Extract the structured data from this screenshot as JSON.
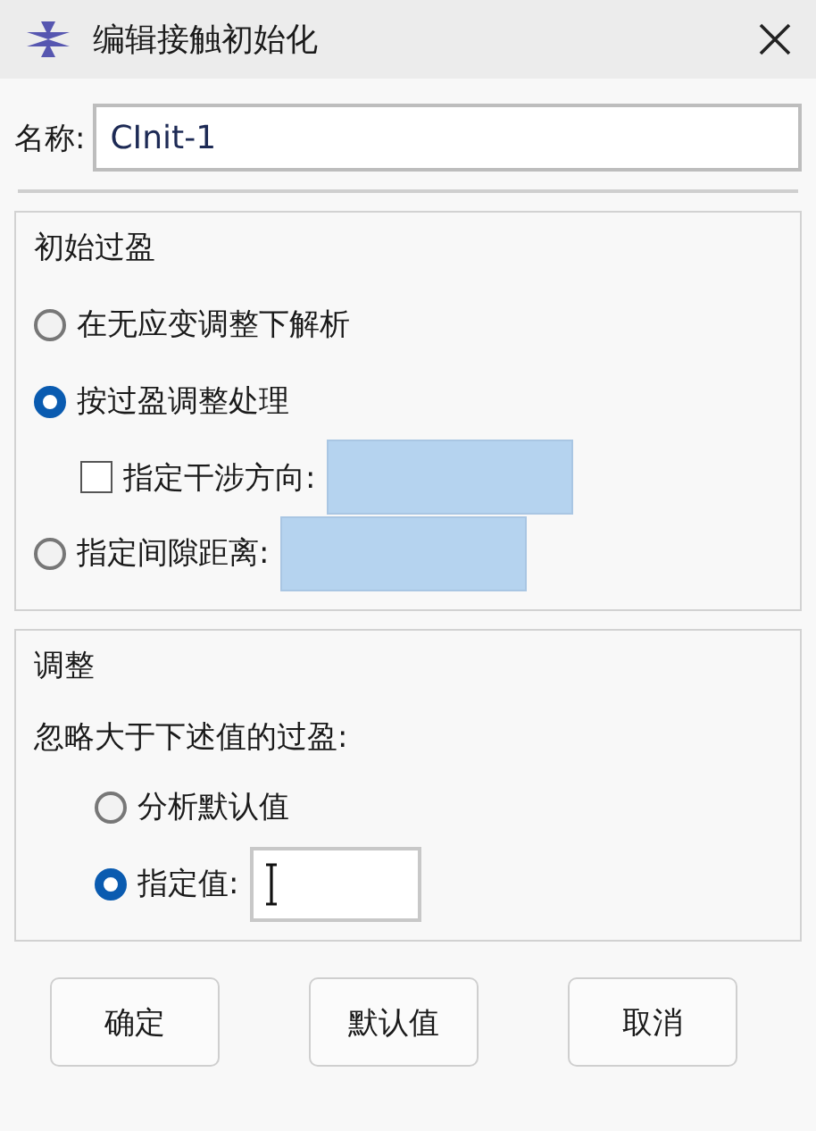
{
  "window": {
    "title": "编辑接触初始化"
  },
  "name_field": {
    "label": "名称:",
    "value": "CInit-1"
  },
  "interference": {
    "title": "初始过盈",
    "options": [
      {
        "kind": "radio",
        "label": "在无应变调整下解析",
        "selected": false
      },
      {
        "kind": "radio",
        "label": "按过盈调整处理",
        "selected": true,
        "sub": {
          "kind": "checkbox_field",
          "label": "指定干涉方向:",
          "checked": false
        }
      },
      {
        "kind": "radio_field",
        "label": "指定间隙距离:",
        "selected": false
      }
    ]
  },
  "adjustment": {
    "title": "调整",
    "prompt": "忽略大于下述值的过盈:",
    "options": [
      {
        "kind": "radio",
        "label": "分析默认值",
        "selected": false
      },
      {
        "kind": "radio_field",
        "label": "指定值:",
        "selected": true
      }
    ]
  },
  "buttons": [
    "确定",
    "默认值",
    "取消"
  ]
}
